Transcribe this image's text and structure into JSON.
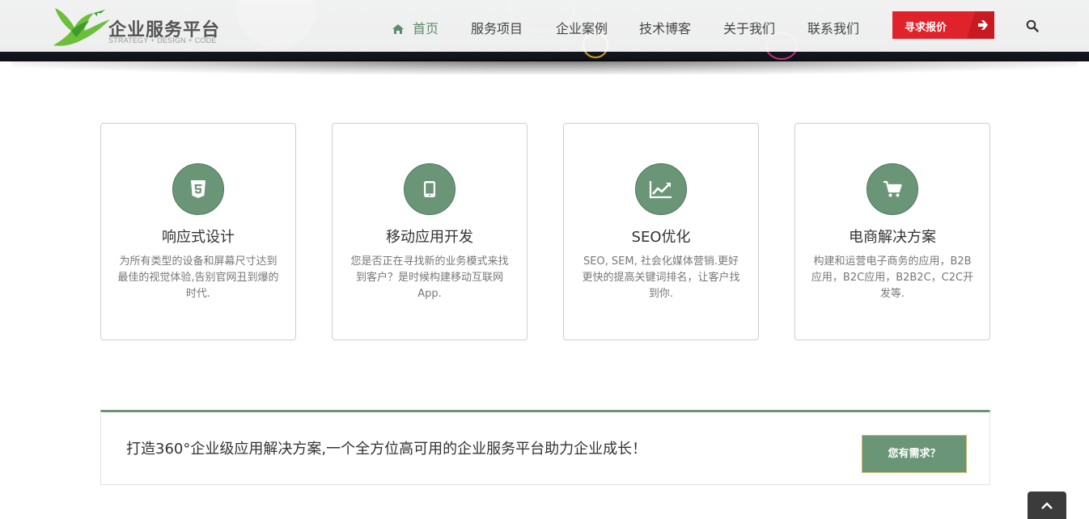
{
  "header": {
    "logo_title": "企业服务平台",
    "logo_subtitle": "STRATEGY + DESIGN + CODE",
    "nav": [
      {
        "label": "首页",
        "active": true
      },
      {
        "label": "服务项目",
        "active": false
      },
      {
        "label": "企业案例",
        "active": false
      },
      {
        "label": "技术博客",
        "active": false
      },
      {
        "label": "关于我们",
        "active": false
      },
      {
        "label": "联系我们",
        "active": false
      }
    ],
    "quote_button": "寻求报价",
    "search_icon": "search-icon"
  },
  "services": [
    {
      "icon": "html5-icon",
      "title": "响应式设计",
      "desc": "为所有类型的设备和屏幕尺寸达到最佳的视觉体验,告别官网丑到爆的时代."
    },
    {
      "icon": "tablet-icon",
      "title": "移动应用开发",
      "desc": "您是否正在寻找新的业务模式来找到客户？是时候构建移动互联网App."
    },
    {
      "icon": "area-chart-icon",
      "title": "SEO优化",
      "desc": "SEO, SEM, 社会化媒体营销.更好更快的提高关键词排名，让客户找到你."
    },
    {
      "icon": "shopping-cart-icon",
      "title": "电商解决方案",
      "desc": "构建和运营电子商务的应用，B2B应用，B2C应用，B2B2C，C2C开发等."
    }
  ],
  "cta": {
    "text": "打造360°企业级应用解决方案,一个全方位高可用的企业服务平台助力企业成长！",
    "button": "您有需求？"
  },
  "colors": {
    "accent_green": "#6a9577",
    "quote_red": "#e0232b",
    "nav_active": "#5c8c6b"
  }
}
